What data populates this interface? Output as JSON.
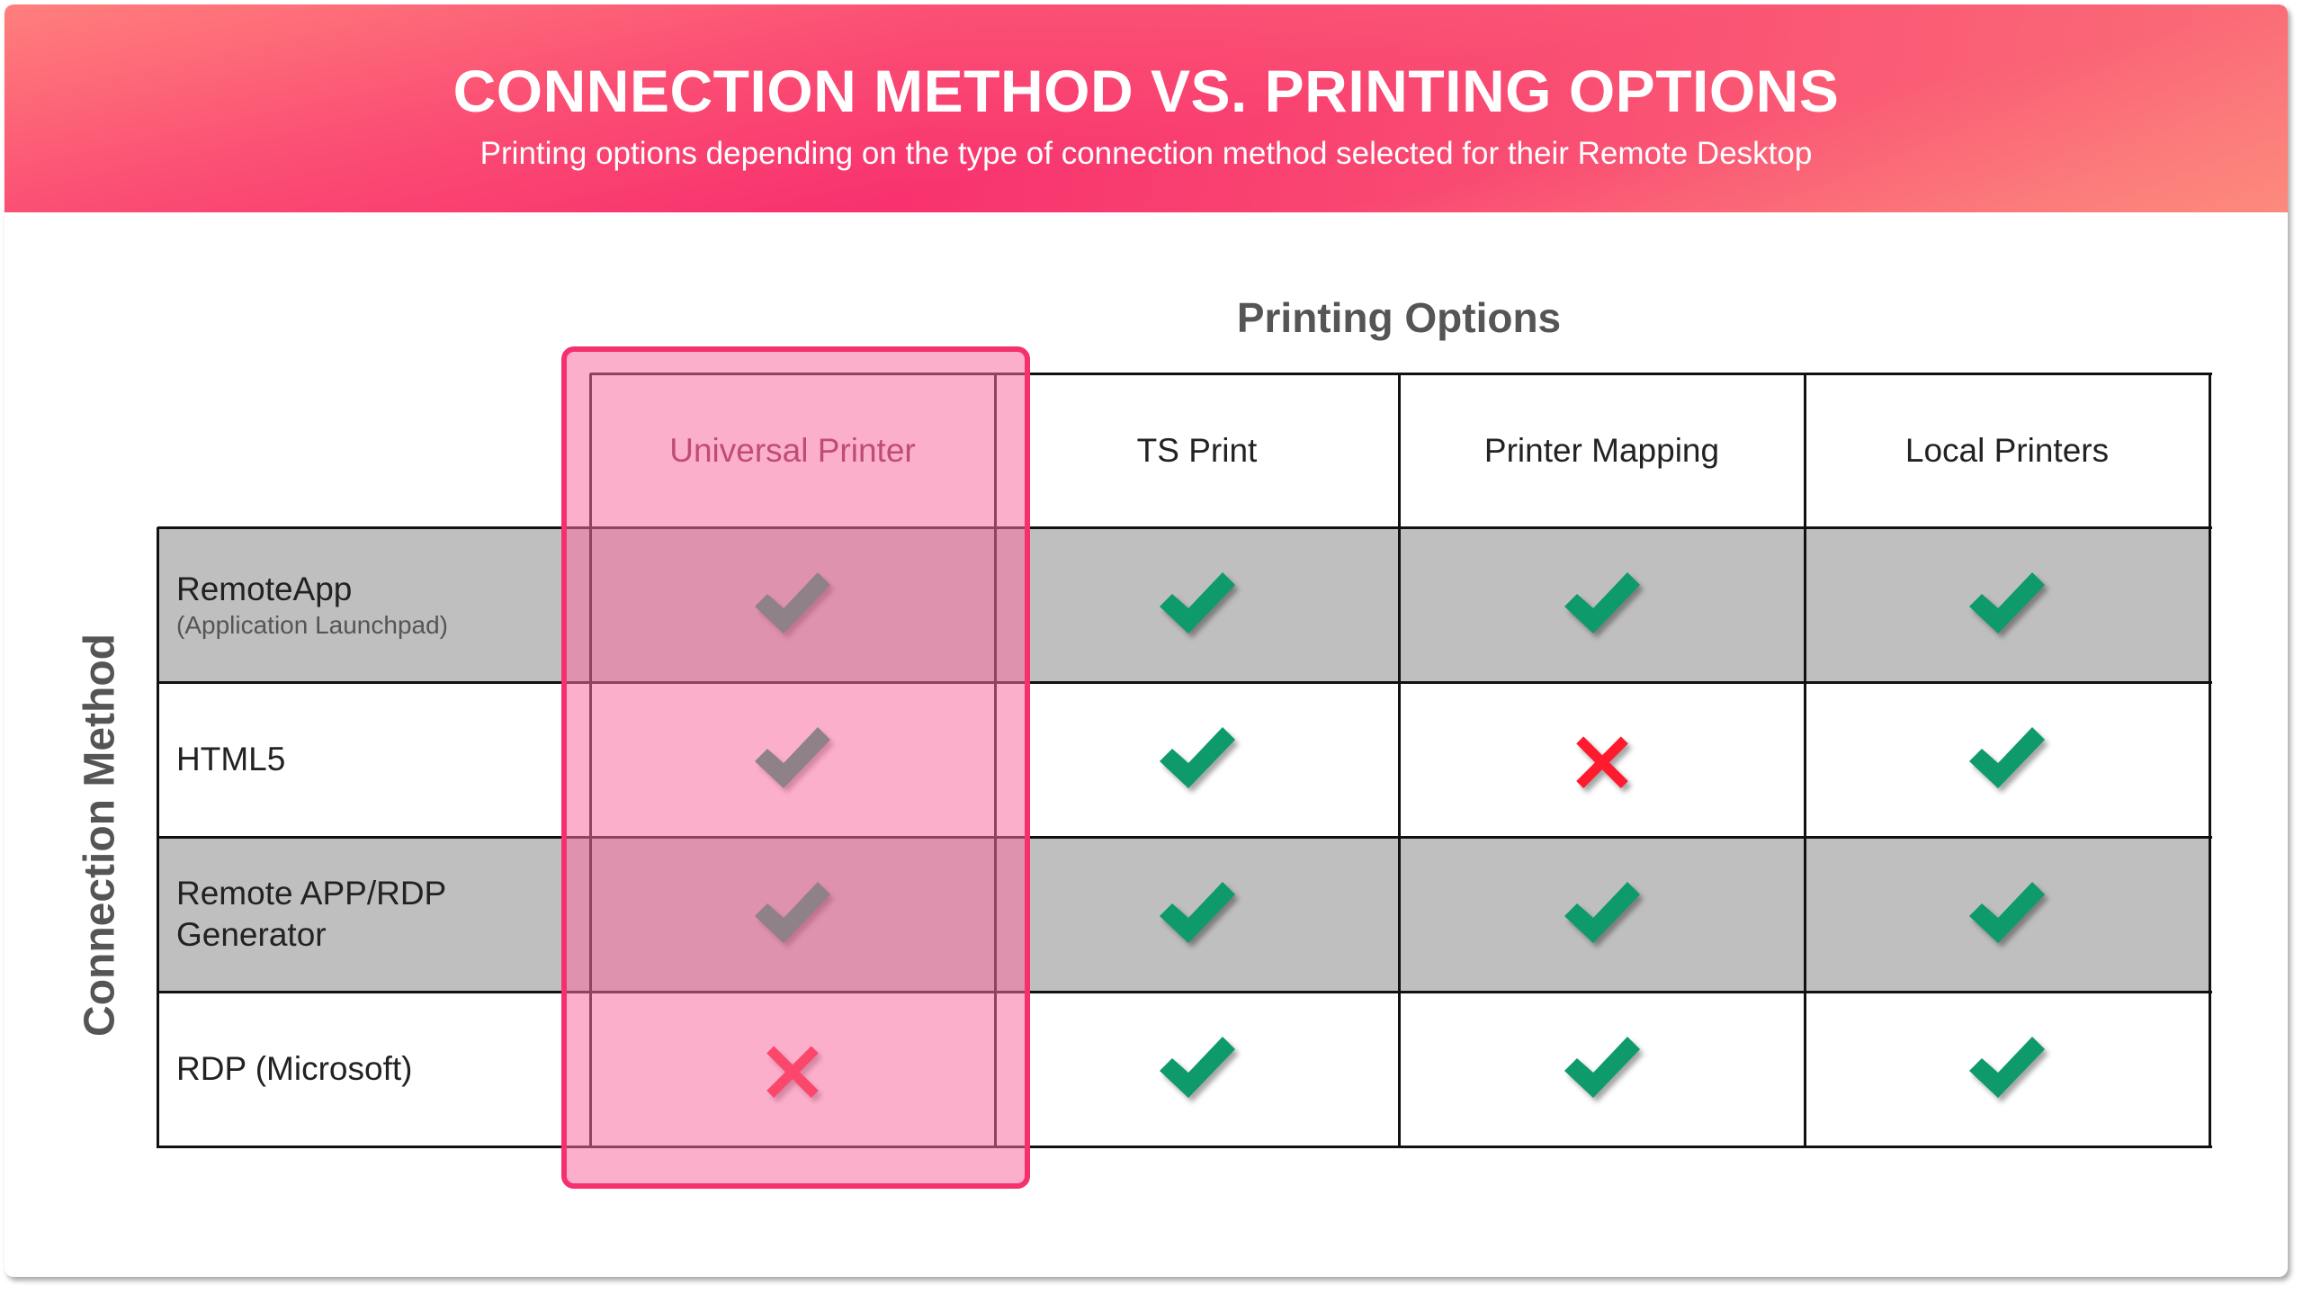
{
  "header": {
    "title": "CONNECTION METHOD VS. PRINTING OPTIONS",
    "subtitle": "Printing options depending on the type of connection method selected for their Remote Desktop"
  },
  "axes": {
    "columns_heading": "Printing Options",
    "rows_heading": "Connection Method"
  },
  "colors": {
    "banner_primary": "#f8326e",
    "banner_secondary": "#fd9a80",
    "highlight_border": "#f5306e",
    "check_green": "#0e9a6a",
    "cross_red": "#ff1a2e",
    "row_gray": "#bfbfbf"
  },
  "table": {
    "highlighted_column": 0,
    "columns": [
      {
        "label": "Universal Printer"
      },
      {
        "label": "TS Print"
      },
      {
        "label": "Printer Mapping"
      },
      {
        "label": "Local Printers"
      }
    ],
    "rows": [
      {
        "label": "RemoteApp",
        "sublabel": "(Application Launchpad)",
        "shaded": true,
        "values": [
          "check",
          "check",
          "check",
          "check"
        ]
      },
      {
        "label": "HTML5",
        "sublabel": "",
        "shaded": false,
        "values": [
          "check",
          "check",
          "cross",
          "check"
        ]
      },
      {
        "label": "Remote APP/RDP Generator",
        "sublabel": "",
        "shaded": true,
        "values": [
          "check",
          "check",
          "check",
          "check"
        ]
      },
      {
        "label": "RDP (Microsoft)",
        "sublabel": "",
        "shaded": false,
        "values": [
          "cross",
          "check",
          "check",
          "check"
        ]
      }
    ]
  }
}
